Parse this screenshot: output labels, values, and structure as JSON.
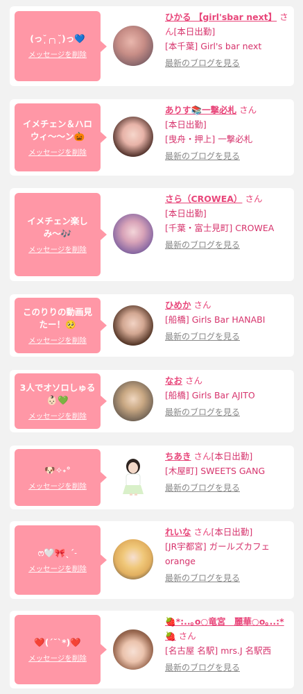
{
  "delete_label": "メッセージを削除",
  "blog_label": "最新のブログを見る",
  "san_label": "さん",
  "cards": [
    {
      "message": "(っ˘̩╭╮˘̩)っ💙",
      "name": "ひかる 【girl'sbar next】",
      "status": "[本日出勤]",
      "shop": "[本千葉] Girl's bar next"
    },
    {
      "message": "イメチェン＆ハロウィ〜〜ン🎃",
      "name": "ありす📚一撃必札",
      "status": "[本日出勤]",
      "shop": "[曳舟・押上] 一撃必札"
    },
    {
      "message": "イメチェン楽しみ〜🎶",
      "name": "さら（CROWEA）",
      "status": "[本日出勤]",
      "shop": "[千葉・富士見町] CROWEA"
    },
    {
      "message": "このりりの動画見たー！🥺",
      "name": "ひめか",
      "status": "",
      "shop": "[船橋] Girls Bar HANABI"
    },
    {
      "message": "3人でオソロしゅる👶🏻💚",
      "name": "なお",
      "status": "",
      "shop": "[船橋] Girls Bar AJITO"
    },
    {
      "message": "🐶✧˖°",
      "name": "ちあき",
      "status": "[本日出勤]",
      "shop": "[木屋町] SWEETS GANG"
    },
    {
      "message": "ෆ🤍🎀ˎˊ˗",
      "name": "れいな",
      "status": "[本日出勤]",
      "shop": "[JR宇都宮] ガールズカフェ orange"
    },
    {
      "message": "❤️(ˊ˘ˋ*)❤️",
      "name": "🍓*:..｡o○竜宮　麗華○o｡..:*🍓",
      "status": "",
      "shop": "[名古屋 名駅] mrs.J 名駅西"
    }
  ]
}
